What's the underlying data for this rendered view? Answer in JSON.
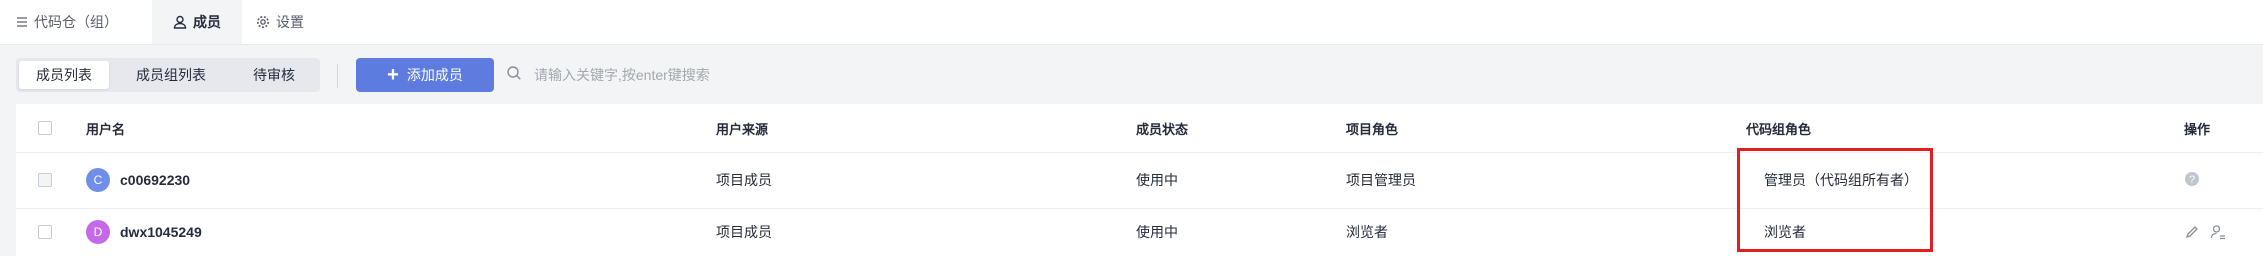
{
  "tabs": [
    {
      "label": "代码仓（组）",
      "icon": "list-icon"
    },
    {
      "label": "成员",
      "icon": "user-icon"
    },
    {
      "label": "设置",
      "icon": "gear-icon"
    }
  ],
  "toolbar": {
    "segments": [
      "成员列表",
      "成员组列表",
      "待审核"
    ],
    "add_label": "添加成员",
    "search_placeholder": "请输入关键字,按enter键搜索"
  },
  "table": {
    "headers": {
      "username": "用户名",
      "source": "用户来源",
      "status": "成员状态",
      "project_role": "项目角色",
      "repo_role": "代码组角色",
      "ops": "操作"
    },
    "rows": [
      {
        "avatar_letter": "C",
        "avatar_color": "#6f8ee8",
        "username": "c00692230",
        "source": "项目成员",
        "status": "使用中",
        "project_role": "项目管理员",
        "repo_role": "管理员（代码组所有者）",
        "ops_icons": [
          "help-icon"
        ]
      },
      {
        "avatar_letter": "D",
        "avatar_color": "#c46ae8",
        "username": "dwx1045249",
        "source": "项目成员",
        "status": "使用中",
        "project_role": "浏览者",
        "repo_role": "浏览者",
        "ops_icons": [
          "edit-icon",
          "user-settings-icon"
        ]
      }
    ]
  },
  "colors": {
    "primary": "#5e7ce0",
    "highlight_border": "#e02020"
  }
}
